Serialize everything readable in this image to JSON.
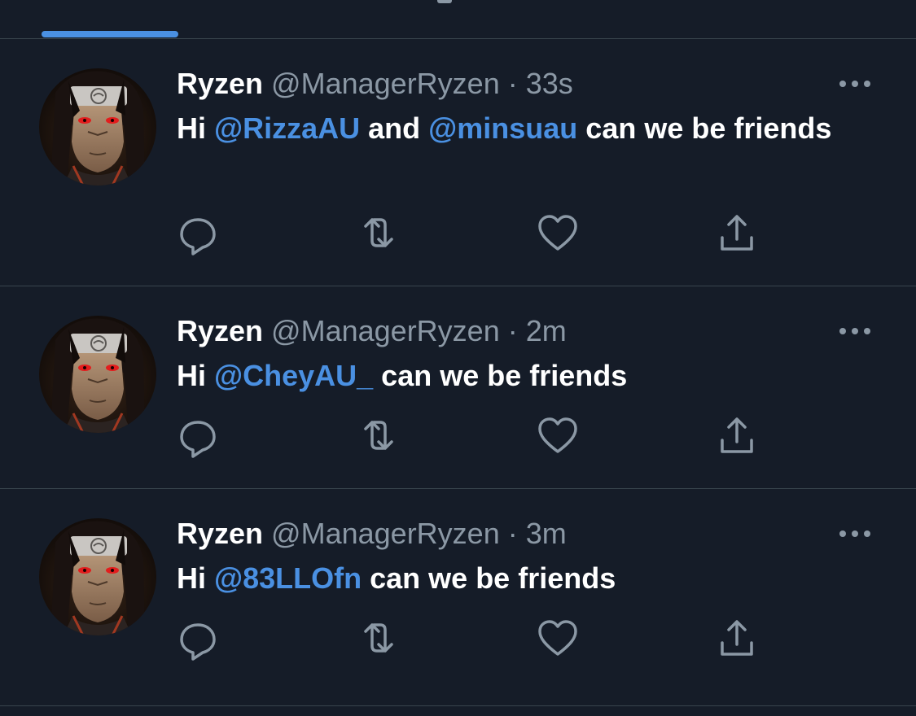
{
  "colors": {
    "background": "#151c28",
    "text_primary": "#ffffff",
    "text_secondary": "#8b98a5",
    "accent": "#4a90e2",
    "divider": "#38444d"
  },
  "tweets": [
    {
      "name": "Ryzen",
      "handle": "@ManagerRyzen",
      "separator": "·",
      "time": "33s",
      "text_segments": [
        {
          "text": "Hi ",
          "mention": false
        },
        {
          "text": "@RizzaAU",
          "mention": true
        },
        {
          "text": " and ",
          "mention": false
        },
        {
          "text": "@minsuau",
          "mention": true
        },
        {
          "text": " can we be friends",
          "mention": false
        }
      ],
      "actions": [
        "reply-icon",
        "retweet-icon",
        "like-icon",
        "share-icon"
      ],
      "more_icon": "more-icon"
    },
    {
      "name": "Ryzen",
      "handle": "@ManagerRyzen",
      "separator": "·",
      "time": "2m",
      "text_segments": [
        {
          "text": "Hi ",
          "mention": false
        },
        {
          "text": "@CheyAU_",
          "mention": true
        },
        {
          "text": " can we be friends",
          "mention": false
        }
      ],
      "actions": [
        "reply-icon",
        "retweet-icon",
        "like-icon",
        "share-icon"
      ],
      "more_icon": "more-icon"
    },
    {
      "name": "Ryzen",
      "handle": "@ManagerRyzen",
      "separator": "·",
      "time": "3m",
      "text_segments": [
        {
          "text": "Hi ",
          "mention": false
        },
        {
          "text": "@83LLOfn",
          "mention": true
        },
        {
          "text": " can we be friends",
          "mention": false
        }
      ],
      "actions": [
        "reply-icon",
        "retweet-icon",
        "like-icon",
        "share-icon"
      ],
      "more_icon": "more-icon"
    }
  ]
}
